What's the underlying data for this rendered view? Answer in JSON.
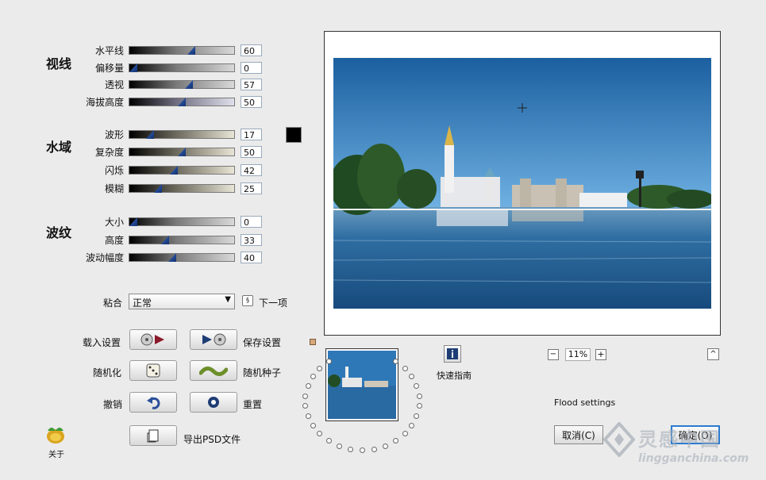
{
  "sections": {
    "view": {
      "title": "视线",
      "sliders": [
        {
          "label": "水平线",
          "value": "60",
          "fraction": 0.6
        },
        {
          "label": "偏移量",
          "value": "0",
          "fraction": 0.0
        },
        {
          "label": "透视",
          "value": "57",
          "fraction": 0.57
        },
        {
          "label": "海拔高度",
          "value": "50",
          "fraction": 0.5
        }
      ]
    },
    "water": {
      "title": "水域",
      "sliders": [
        {
          "label": "波形",
          "value": "17",
          "fraction": 0.17
        },
        {
          "label": "复杂度",
          "value": "50",
          "fraction": 0.5
        },
        {
          "label": "闪烁",
          "value": "42",
          "fraction": 0.42
        },
        {
          "label": "模糊",
          "value": "25",
          "fraction": 0.25
        }
      ],
      "color_swatch": "#000000"
    },
    "ripple": {
      "title": "波纹",
      "sliders": [
        {
          "label": "大小",
          "value": "0",
          "fraction": 0.0
        },
        {
          "label": "高度",
          "value": "33",
          "fraction": 0.33
        },
        {
          "label": "波动幅度",
          "value": "40",
          "fraction": 0.4
        }
      ]
    }
  },
  "blend": {
    "label": "粘合",
    "selected": "正常",
    "next_label": "下一项",
    "next_icon": "loop-icon"
  },
  "buttons": {
    "load_settings": "载入设置",
    "save_settings": "保存设置",
    "randomize": "随机化",
    "random_seed": "随机种子",
    "undo": "撤销",
    "reset": "重置",
    "export_psd": "导出PSD文件",
    "about": "关于"
  },
  "preview": {
    "zoom": "11%",
    "zoom_minus": "−",
    "zoom_plus": "+",
    "collapse": "^"
  },
  "quick_guide": {
    "label": "快速指南",
    "icon": "info-icon"
  },
  "status": "Flood settings",
  "dialog": {
    "cancel": "取消(C)",
    "ok": "确定(O)"
  },
  "watermark": {
    "brand": "灵感中国",
    "url": "lingganchina.com"
  }
}
